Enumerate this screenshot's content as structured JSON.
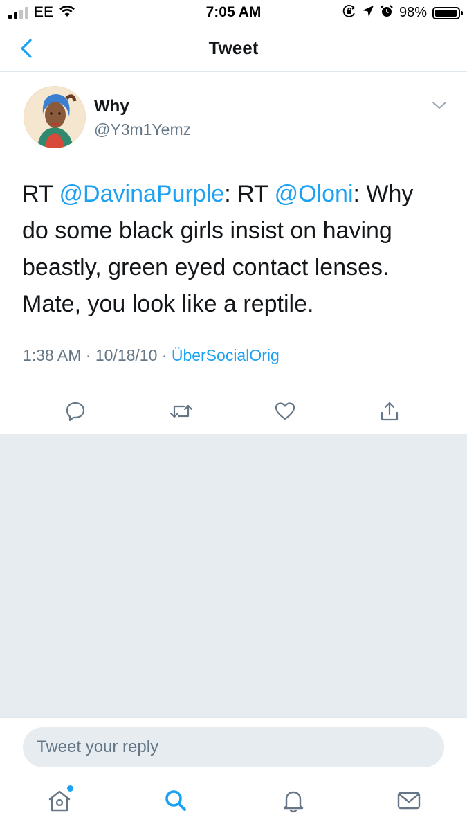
{
  "status_bar": {
    "carrier": "EE",
    "time": "7:05 AM",
    "battery_percent": "98%",
    "battery_level": 0.98,
    "signal_bars": 2,
    "icons": [
      "wifi-icon",
      "orientation-lock-icon",
      "location-arrow-icon",
      "alarm-icon",
      "battery-icon"
    ]
  },
  "nav": {
    "title": "Tweet",
    "back_icon": "chevron-left-icon"
  },
  "tweet": {
    "author_name": "Why",
    "author_handle": "@Y3m1Yemz",
    "text_segments": [
      {
        "text": "RT ",
        "type": "plain"
      },
      {
        "text": "@DavinaPurple",
        "type": "mention"
      },
      {
        "text": ": RT ",
        "type": "plain"
      },
      {
        "text": "@Oloni",
        "type": "mention"
      },
      {
        "text": ": Why do some black girls insist on having beastly, green eyed contact lenses. Mate, you look like a reptile.",
        "type": "plain"
      }
    ],
    "time": "1:38 AM",
    "separator": "·",
    "date": "10/18/10",
    "source": "ÜberSocialOrig"
  },
  "actions": [
    "reply-icon",
    "retweet-icon",
    "like-icon",
    "share-icon"
  ],
  "reply": {
    "placeholder": "Tweet your reply"
  },
  "tabbar": {
    "items": [
      "home-icon",
      "search-icon",
      "notifications-icon",
      "messages-icon"
    ]
  },
  "colors": {
    "accent": "#1da1f2",
    "secondary_text": "#657786",
    "background_gray": "#e6ecf0"
  }
}
